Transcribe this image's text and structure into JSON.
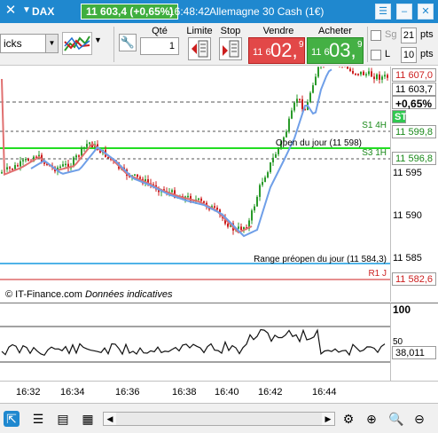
{
  "titlebar": {
    "instrument": "DAX",
    "last_quote": "11 603,4 (+0,65%)",
    "time": "16:48:42",
    "market_name": "Allemagne 30 Cash (1€)"
  },
  "toolbar": {
    "period_value": "icks",
    "qty_label": "Qté",
    "qty_value": "1",
    "limit_label": "Limite",
    "stop_label": "Stop",
    "sell_label": "Vendre",
    "buy_label": "Acheter",
    "sell_price": {
      "prefix": "11 6",
      "main": "02,",
      "sup": "9"
    },
    "buy_price": {
      "prefix": "11 6",
      "main": "03,",
      "sup": "9"
    },
    "sg_label": "Sg",
    "sg_value": "21",
    "l_label": "L",
    "l_value": "10",
    "pts_label": "pts"
  },
  "chart": {
    "yaxis_labels": [
      "11 595",
      "11 590",
      "11 585"
    ],
    "price_boxes": {
      "high": "11 607,0",
      "last": "11 603,7",
      "change": "+0,65%",
      "box2": "11 599,8",
      "box3": "11 596,8",
      "box4": "11 582,6"
    },
    "level_labels": {
      "s1": "S1 4H",
      "open_day": "Open du jour (11 598)",
      "s3": "S3 1H",
      "range": "Range préopen du jour (11 584,3)",
      "r1": "R1 J"
    },
    "st_badge": "ST",
    "copyright": "© IT-Finance.com",
    "disclaimer": "Données indicatives"
  },
  "oscillator": {
    "top_label": "100",
    "mid_label": "50",
    "value": "38,011"
  },
  "xaxis": {
    "labels": [
      "16:32",
      "16:34",
      "16:36",
      "16:38",
      "16:40",
      "16:42",
      "16:44"
    ]
  },
  "colors": {
    "titlebar": "#1f88cf",
    "up_candle": "#2a9a2a",
    "down_candle": "#cc1e1e",
    "ma_red": "#e07070",
    "ma_blue": "#6f9fe8",
    "open_line": "#22dd22",
    "range_line": "#4fb3e8",
    "r1_line": "#cc2020"
  }
}
